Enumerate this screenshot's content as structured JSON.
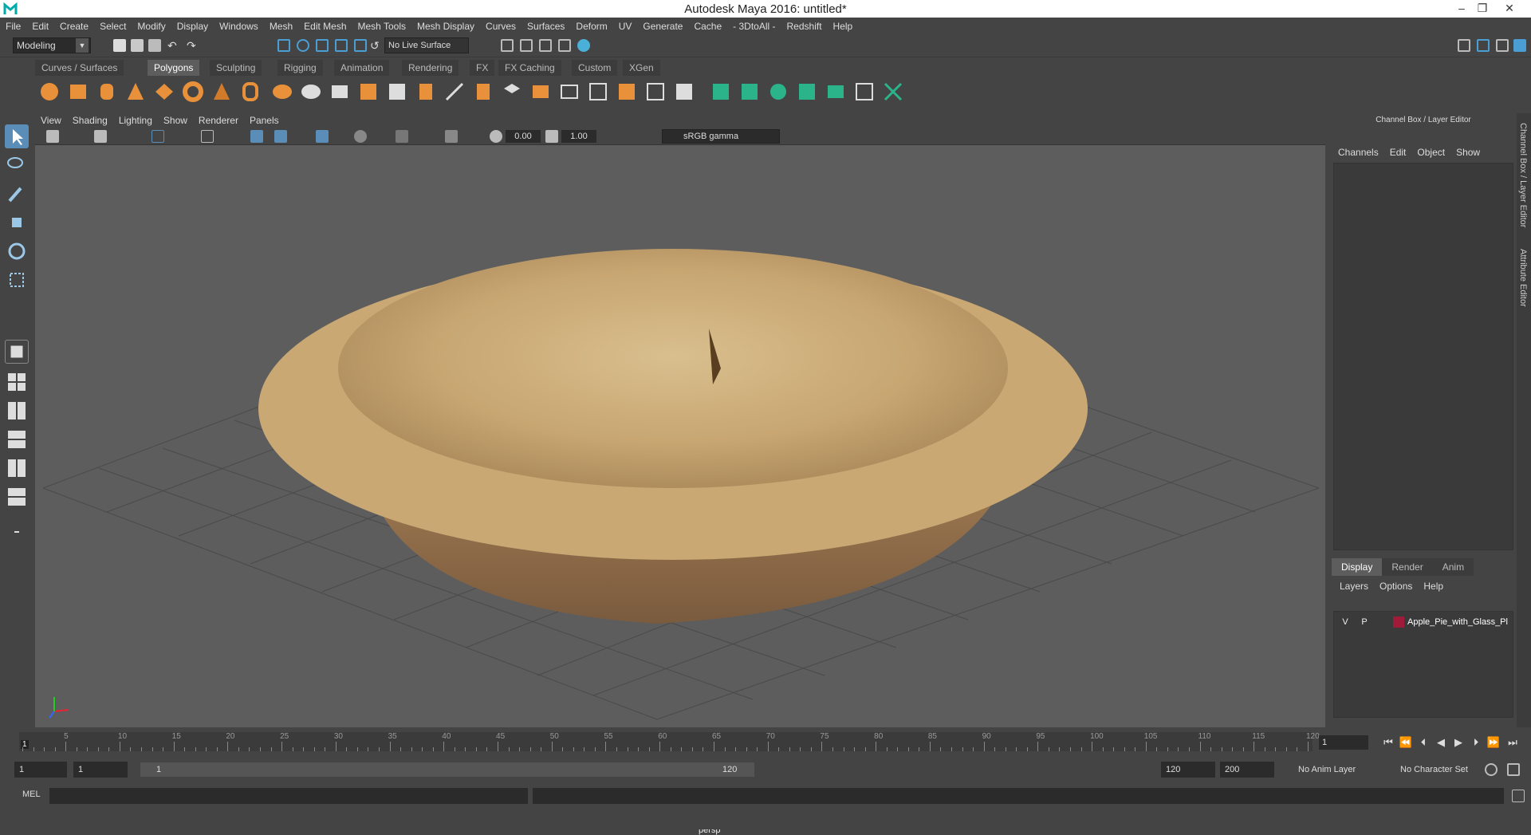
{
  "window": {
    "title": "Autodesk Maya 2016: untitled*"
  },
  "menubar": [
    "File",
    "Edit",
    "Create",
    "Select",
    "Modify",
    "Display",
    "Windows",
    "Mesh",
    "Edit Mesh",
    "Mesh Tools",
    "Mesh Display",
    "Curves",
    "Surfaces",
    "Deform",
    "UV",
    "Generate",
    "Cache",
    "- 3DtoAll -",
    "Redshift",
    "Help"
  ],
  "status": {
    "mode": "Modeling",
    "live_surface": "No Live Surface"
  },
  "shelf_tabs": [
    "Curves / Surfaces",
    "Polygons",
    "Sculpting",
    "Rigging",
    "Animation",
    "Rendering",
    "FX",
    "FX Caching",
    "Custom",
    "XGen"
  ],
  "shelf_active": "Polygons",
  "viewport": {
    "menu": [
      "View",
      "Shading",
      "Lighting",
      "Show",
      "Renderer",
      "Panels"
    ],
    "exposure": "0.00",
    "gamma_value": "1.00",
    "color_space": "sRGB gamma",
    "camera": "persp"
  },
  "channel_box": {
    "header": "Channel Box / Layer Editor",
    "menu": [
      "Channels",
      "Edit",
      "Object",
      "Show"
    ]
  },
  "layer_editor": {
    "tabs": [
      "Display",
      "Render",
      "Anim"
    ],
    "active_tab": "Display",
    "menu": [
      "Layers",
      "Options",
      "Help"
    ],
    "layers": [
      {
        "v": "V",
        "p": "P",
        "name": "Apple_Pie_with_Glass_Pl",
        "color": "#a01b3a"
      }
    ]
  },
  "side_tabs": [
    "Channel Box / Layer Editor",
    "Attribute Editor"
  ],
  "timeline": {
    "ticks": [
      "5",
      "10",
      "15",
      "20",
      "25",
      "30",
      "35",
      "40",
      "45",
      "50",
      "55",
      "60",
      "65",
      "70",
      "75",
      "80",
      "85",
      "90",
      "95",
      "100",
      "105",
      "110",
      "115",
      "120"
    ],
    "current_frame_marker": "1",
    "current_frame": "1"
  },
  "range": {
    "start": "1",
    "playback_start": "1",
    "slider_start": "1",
    "slider_end": "120",
    "playback_end": "120",
    "end": "200",
    "anim_layer": "No Anim Layer",
    "character_set": "No Character Set"
  },
  "command_line": {
    "label": "MEL"
  }
}
